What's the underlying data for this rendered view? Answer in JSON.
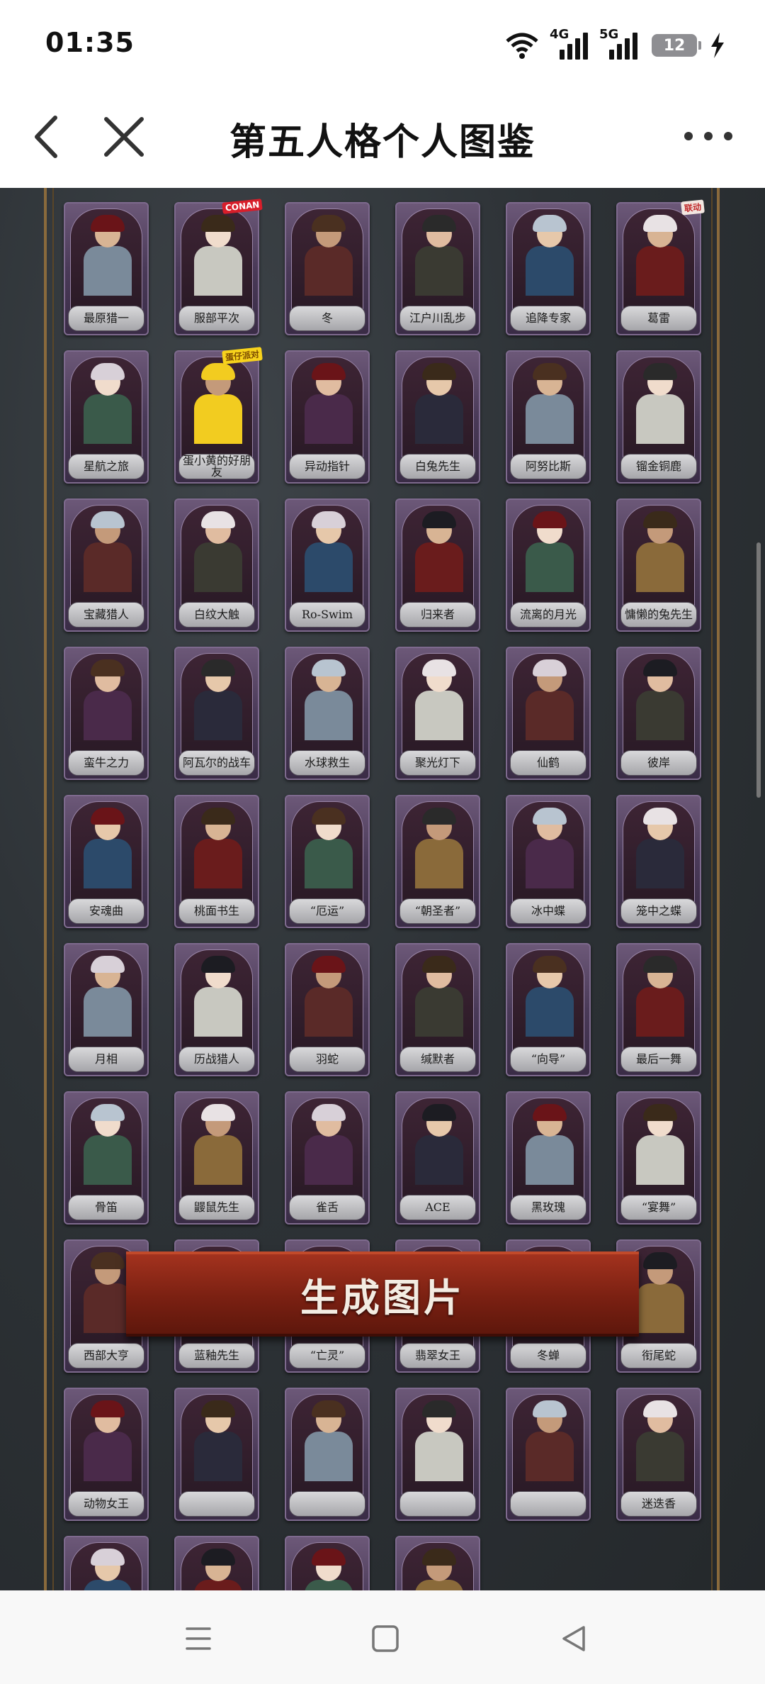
{
  "status_bar": {
    "time": "01:35",
    "net1": "4G",
    "net2": "5G",
    "battery": "12"
  },
  "nav": {
    "title": "第五人格个人图鉴"
  },
  "colors": {
    "accent": "#a3321e",
    "frame": "#8a6a3c",
    "card": "#4a3a58",
    "background": "#2d3236"
  },
  "rows": [
    [
      "最原猎一",
      "服部平次",
      "冬",
      "江户川乱步",
      "追降专家",
      "葛雷"
    ],
    [
      "星航之旅",
      "蛋小黄的好朋友",
      "异动指针",
      "白兔先生",
      "阿努比斯",
      "镏金铜鹿"
    ],
    [
      "宝藏猎人",
      "白纹大触",
      "Ro-Swim",
      "归来者",
      "流离的月光",
      "慵懒的兔先生"
    ],
    [
      "蛮牛之力",
      "阿瓦尔的战车",
      "水球救生",
      "聚光灯下",
      "仙鹤",
      "彼岸"
    ],
    [
      "安魂曲",
      "桃面书生",
      "“厄运”",
      "“朝圣者”",
      "冰中蝶",
      "笼中之蝶"
    ],
    [
      "月相",
      "历战猎人",
      "羽蛇",
      "缄默者",
      "“向导”",
      "最后一舞"
    ],
    [
      "骨笛",
      "鼹鼠先生",
      "雀舌",
      "ACE",
      "黑玫瑰",
      "“宴舞”"
    ],
    [
      "西部大亨",
      "蓝釉先生",
      "“亡灵”",
      "翡翠女王",
      "冬蝉",
      "衔尾蛇"
    ],
    [
      "动物女王",
      "",
      "",
      "",
      "",
      "迷迭香"
    ],
    [
      "",
      "",
      "",
      ""
    ]
  ],
  "badges": {
    "conan": "CONAN",
    "collab": "联动",
    "egg": "蛋仔派对"
  },
  "generate_button": "生成图片"
}
